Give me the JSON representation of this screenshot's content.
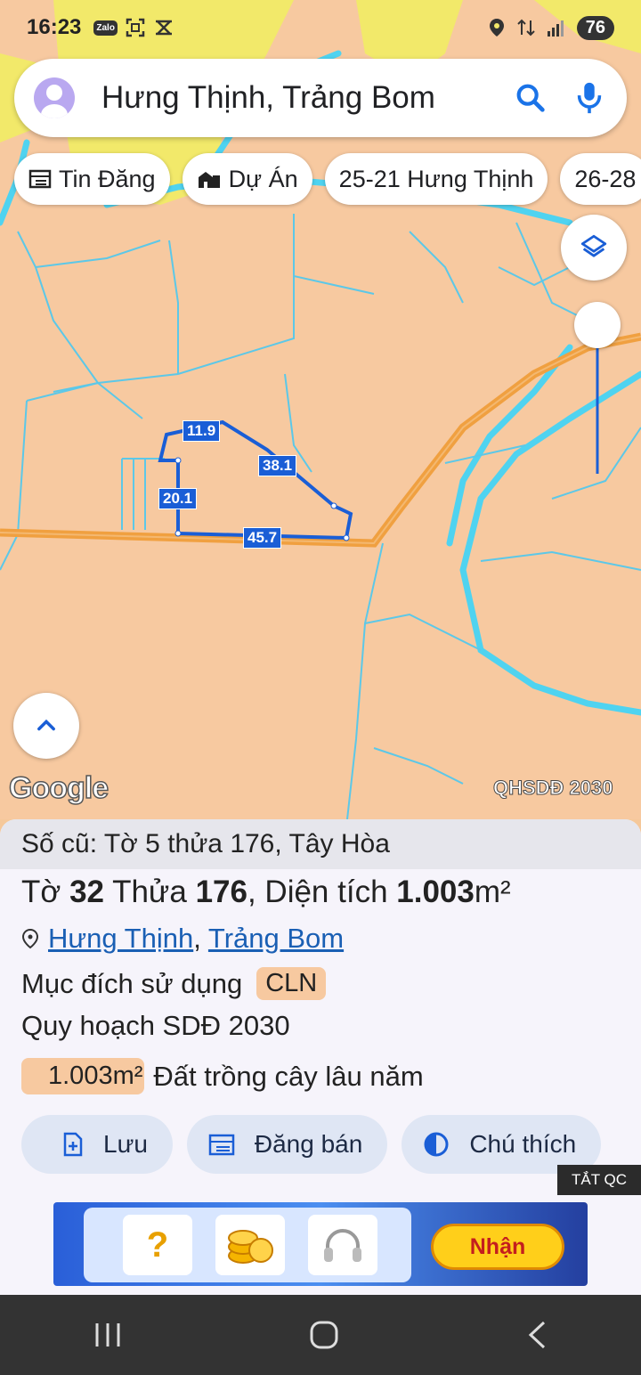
{
  "status": {
    "time": "16:23",
    "left_icons": [
      "zalo-icon",
      "screenshot-icon",
      "capcut-icon"
    ],
    "zalo_label": "Zalo",
    "battery": "76"
  },
  "search": {
    "text": "Hưng Thịnh, Trảng Bom"
  },
  "chips": [
    {
      "label": "Tin Đăng",
      "icon": "calendar-list-icon"
    },
    {
      "label": "Dự Án",
      "icon": "buildings-icon"
    },
    {
      "label": "25-21 Hưng Thịnh"
    },
    {
      "label": "26-28"
    }
  ],
  "map": {
    "parcel_labels": [
      "11.9",
      "38.1",
      "20.1",
      "45.7"
    ],
    "google_logo": "Google",
    "layer_name": "QHSDĐ 2030"
  },
  "sheet": {
    "old_info": "Số cũ: Tờ 5 thửa 176, Tây Hòa",
    "main": {
      "to_label": "Tờ ",
      "to_value": "32",
      "thua_label": " Thửa ",
      "thua_value": "176",
      "area_label": ", Diện tích ",
      "area_value": "1.003",
      "area_unit": "m²"
    },
    "location": {
      "ward": "Hưng Thịnh",
      "separator": ", ",
      "district": "Trảng Bom"
    },
    "purpose_label": "Mục đích sử dụng",
    "purpose_code": "CLN",
    "planning": "Quy hoạch SDĐ 2030",
    "planning_area": "1.003m²",
    "planning_desc": "Đất trồng cây lâu năm",
    "actions": [
      {
        "label": "Lưu",
        "icon": "bookmark-add-icon"
      },
      {
        "label": "Đăng bán",
        "icon": "listing-icon"
      },
      {
        "label": "Chú thích",
        "icon": "contrast-icon"
      }
    ],
    "close_ad": "TẮT QC"
  },
  "ad": {
    "button": "Nhận",
    "tiles": [
      "?",
      "coins",
      "headphones"
    ]
  },
  "colors": {
    "land": "#f7c9a0",
    "river": "#4fd3f0",
    "road": "#f0a040",
    "parcel": "#1a5ed6",
    "accent": "#1a73e8"
  }
}
